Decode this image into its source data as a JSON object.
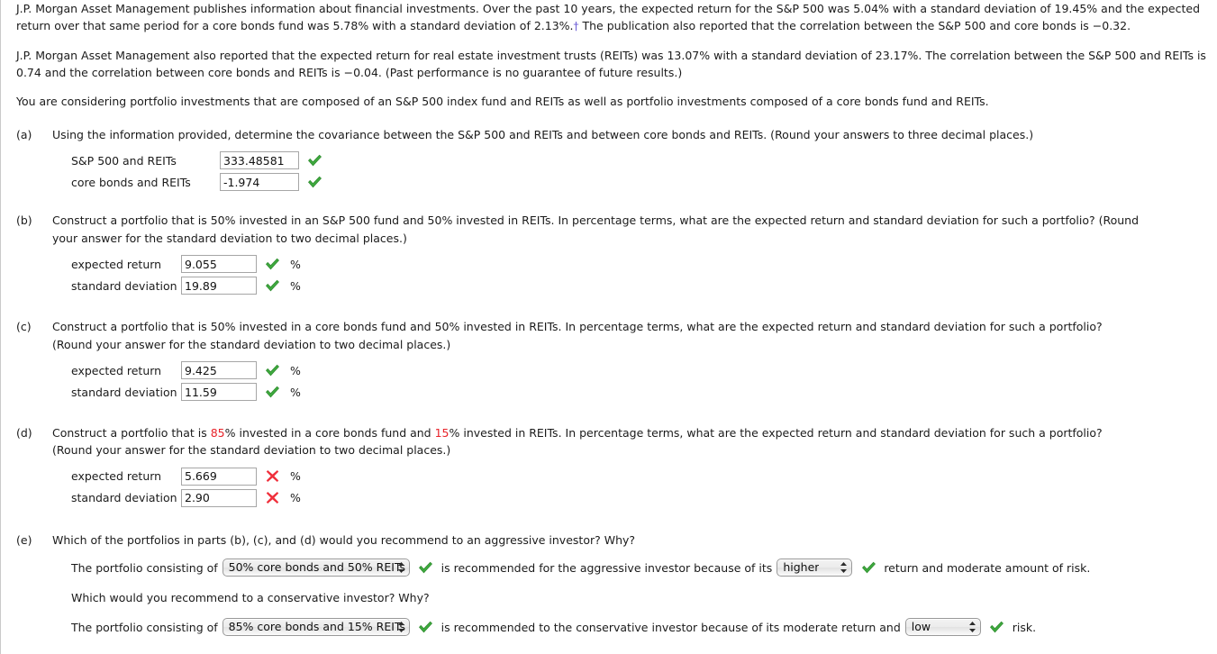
{
  "intro": {
    "paragraph1": "J.P. Morgan Asset Management publishes information about financial investments. Over the past 10 years, the expected return for the S&P 500 was 5.04% with a standard deviation of 19.45% and the expected return over that same period for a core bonds fund was 5.78% with a standard deviation of 2.13%.",
    "dagger": "†",
    "paragraph1_cont": " The publication also reported that the correlation between the S&P 500 and core bonds is −0.32.",
    "paragraph2": "J.P. Morgan Asset Management also reported that the expected return for real estate investment trusts (REITs) was 13.07% with a standard deviation of 23.17%. The correlation between the S&P 500 and REITs is 0.74 and the correlation between core bonds and REITs is −0.04. (Past performance is no guarantee of future results.)",
    "paragraph3": "You are considering portfolio investments that are composed of an S&P 500 index fund and REITs as well as portfolio investments composed of a core bonds fund and REITs."
  },
  "parts": {
    "a": {
      "label": "(a)",
      "question": "Using the information provided, determine the covariance between the S&P 500 and REITs and between core bonds and REITs. (Round your answers to three decimal places.)",
      "rows": [
        {
          "label": "S&P 500 and REITs",
          "value": "333.48581",
          "status": "correct"
        },
        {
          "label": "core bonds and REITs",
          "value": "-1.974",
          "status": "correct"
        }
      ]
    },
    "b": {
      "label": "(b)",
      "question_line1": "Construct a portfolio that is 50% invested in an S&P 500 fund and 50% invested in REITs. In percentage terms, what are the expected return and standard deviation for such a portfolio? (Round",
      "question_line2": "your answer for the standard deviation to two decimal places.)",
      "rows": [
        {
          "label": "expected return",
          "value": "9.055",
          "status": "correct",
          "unit": "%"
        },
        {
          "label": "standard deviation",
          "value": "19.89",
          "status": "correct",
          "unit": "%"
        }
      ]
    },
    "c": {
      "label": "(c)",
      "question_line1": "Construct a portfolio that is 50% invested in a core bonds fund and 50% invested in REITs. In percentage terms, what are the expected return and standard deviation for such a portfolio?",
      "question_line2": "(Round your answer for the standard deviation to two decimal places.)",
      "rows": [
        {
          "label": "expected return",
          "value": "9.425",
          "status": "correct",
          "unit": "%"
        },
        {
          "label": "standard deviation",
          "value": "11.59",
          "status": "correct",
          "unit": "%"
        }
      ]
    },
    "d": {
      "label": "(d)",
      "question_part1": "Construct a portfolio that is ",
      "question_hl1": "85",
      "question_part2": "% invested in a core bonds fund and ",
      "question_hl2": "15",
      "question_part3": "% invested in REITs. In percentage terms, what are the expected return and standard deviation for such a portfolio?",
      "question_line2": "(Round your answer for the standard deviation to two decimal places.)",
      "rows": [
        {
          "label": "expected return",
          "value": "5.669",
          "status": "incorrect",
          "unit": "%"
        },
        {
          "label": "standard deviation",
          "value": "2.90",
          "status": "incorrect",
          "unit": "%"
        }
      ]
    },
    "e": {
      "label": "(e)",
      "question": "Which of the portfolios in parts (b), (c), and (d) would you recommend to an aggressive investor? Why?",
      "sentence1_pre": "The portfolio consisting of",
      "sentence1_select": "50% core bonds and 50% REITs",
      "sentence1_mid": "is recommended for the aggressive investor because of its",
      "sentence1_select2": "higher",
      "sentence1_post": "return and moderate amount of risk.",
      "question2": "Which would you recommend to a conservative investor? Why?",
      "sentence2_pre": "The portfolio consisting of",
      "sentence2_select": "85% core bonds and 15% REITs",
      "sentence2_mid": "is recommended to the conservative investor because of its moderate return and",
      "sentence2_select2": "low",
      "sentence2_post": "risk."
    }
  },
  "colors": {
    "correct": "#3ea93e",
    "incorrect": "#f0303c",
    "highlight_red": "#e8232a",
    "dagger_purple": "#6b5cd6"
  }
}
